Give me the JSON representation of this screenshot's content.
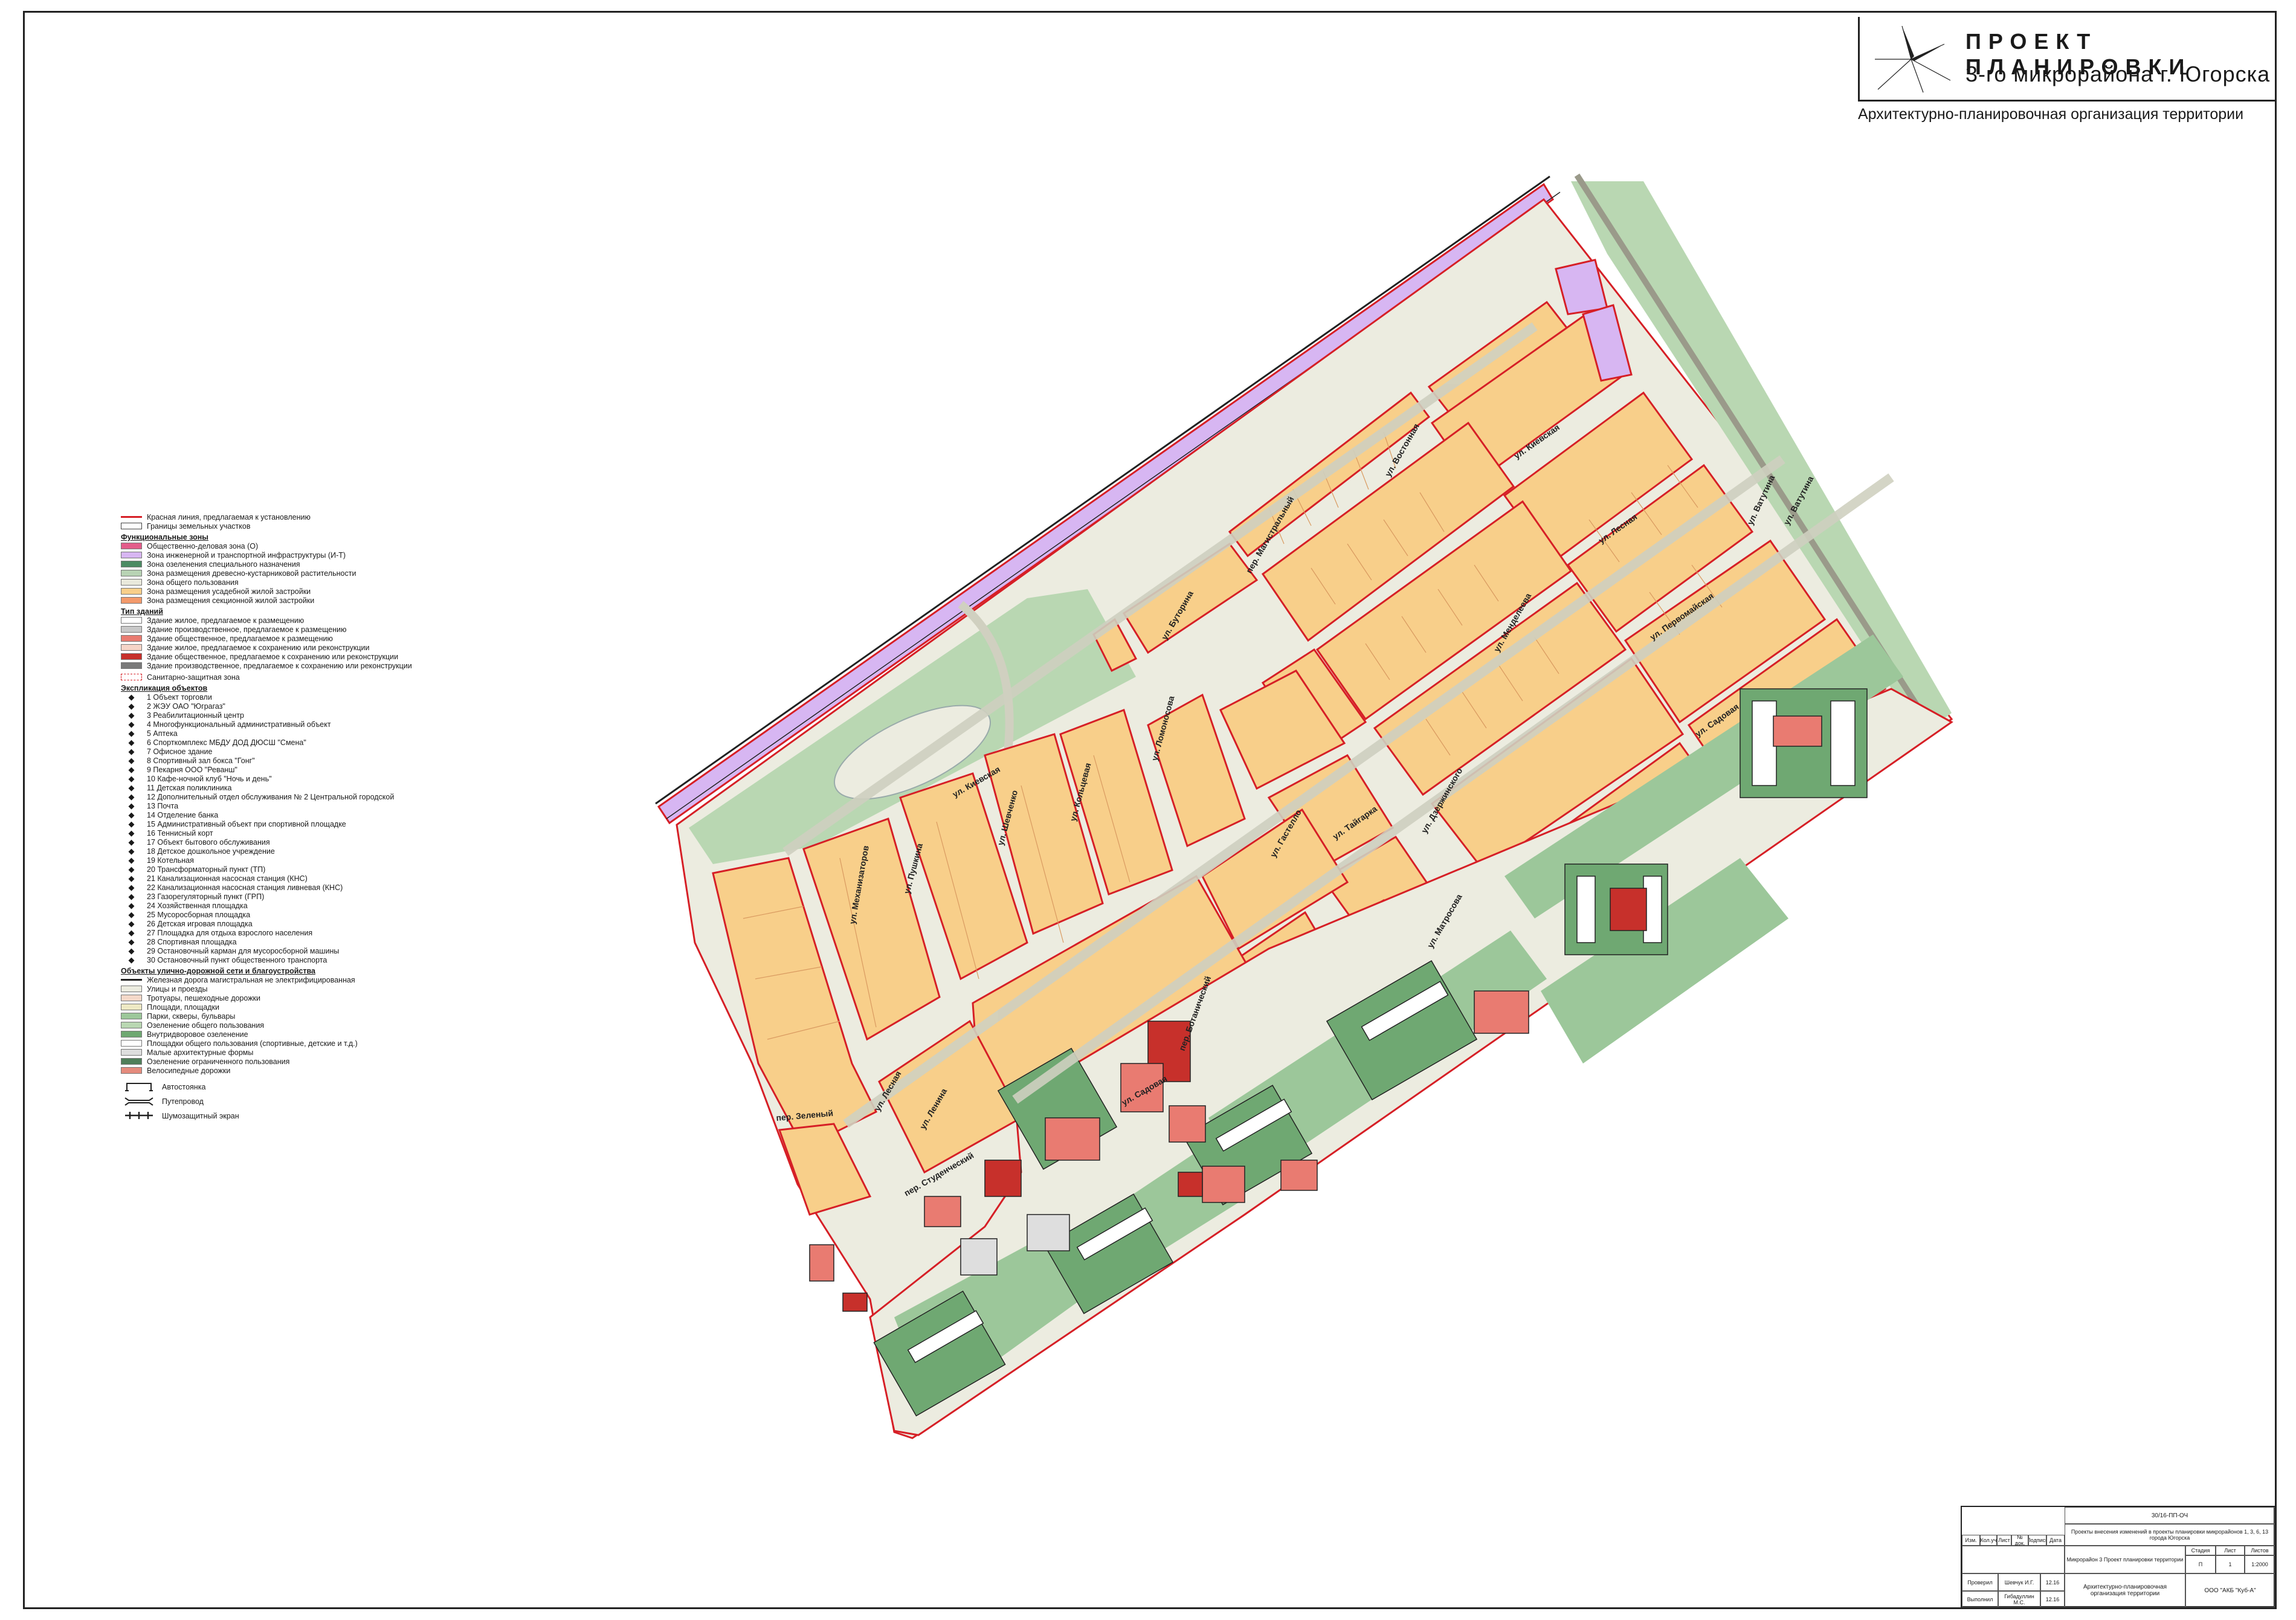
{
  "title": {
    "main": "ПРОЕКТ ПЛАНИРОВКИ",
    "sub": "3-го микрорайона  г. Югорска",
    "sheet": "Архитектурно-планировочная организация территории"
  },
  "legend": {
    "lines": [
      {
        "label": "Красная линия, предлагаемая к установлению",
        "color": "#d61f26"
      },
      {
        "label": "Границы земельных участков",
        "color": "#444444"
      }
    ],
    "zones_title": "Функциональные зоны",
    "zones": [
      {
        "label": "Общественно-деловая зона (О)",
        "color": "#e35d8a"
      },
      {
        "label": "Зона инженерной и транспортной инфраструктуры (И-Т)",
        "color": "#d7b6f2"
      },
      {
        "label": "Зона озеленения специального назначения",
        "color": "#4c8a63"
      },
      {
        "label": "Зона размещения древесно-кустарниковой растительности",
        "color": "#b8d3b4"
      },
      {
        "label": "Зона общего пользования",
        "color": "#e9e9dc"
      },
      {
        "label": "Зона размещения усадебной жилой застройки",
        "color": "#f8cf8a"
      },
      {
        "label": "Зона размещения секционной жилой застройки",
        "color": "#f39a6b"
      }
    ],
    "buildings_title": "Тип зданий",
    "buildings": [
      {
        "label": "Здание жилое, предлагаемое к размещению",
        "color": "#ffffff"
      },
      {
        "label": "Здание производственное, предлагаемое к размещению",
        "color": "#c9c9c9"
      },
      {
        "label": "Здание общественное, предлагаемое к размещению",
        "color": "#e97b71"
      },
      {
        "label": "Здание жилое, предлагаемое к сохранению или реконструкции",
        "color": "#f6d4c7"
      },
      {
        "label": "Здание общественное, предлагаемое к сохранению или реконструкции",
        "color": "#c7302b"
      },
      {
        "label": "Здание производственное, предлагаемое к сохранению или реконструкции",
        "color": "#7a7a7a"
      }
    ],
    "sanitary": "Санитарно-защитная зона",
    "objects_title": "Экспликация объектов",
    "objects": [
      "1  Объект торговли",
      "2  ЖЭУ ОАО \"Юграгаз\"",
      "3  Реабилитационный центр",
      "4  Многофункциональный административный объект",
      "5  Аптека",
      "6  Спорткомплекс МБДУ ДОД ДЮСШ \"Смена\"",
      "7  Офисное здание",
      "8  Спортивный зал бокса \"Гонг\"",
      "9  Пекарня ООО \"Реванш\"",
      "10  Кафе-ночной клуб \"Ночь и день\"",
      "11  Детская поликлиника",
      "12  Дополнительный отдел обслуживания № 2 Центральной городской",
      "13  Почта",
      "14  Отделение банка",
      "15  Административный объект при спортивной площадке",
      "16  Теннисный корт",
      "17  Объект бытового обслуживания",
      "18  Детское дошкольное учреждение",
      "19  Котельная",
      "20  Трансформаторный пункт (ТП)",
      "21  Канализационная насосная станция (КНС)",
      "22  Канализационная насосная станция ливневая (КНС)",
      "23  Газорегуляторный пункт (ГРП)",
      "24  Хозяйственная площадка",
      "25  Мусоросборная площадка",
      "26  Детская игровая площадка",
      "27  Площадка для отдыха взрослого населения",
      "28  Спортивная площадка",
      "29  Остановочный карман для мусоросборной машины",
      "30  Остановочный пункт общественного транспорта"
    ],
    "roads_title": "Объекты улично-дорожной сети и благоустройства",
    "roads": [
      {
        "label": "Железная дорога магистральная не электрифицированная",
        "color": "#222222",
        "kind": "line"
      },
      {
        "label": "Улицы и проезды",
        "color": "#ecece0",
        "kind": "box"
      },
      {
        "label": "Тротуары, пешеходные дорожки",
        "color": "#f4d9c9",
        "kind": "box"
      },
      {
        "label": "Площади, площадки",
        "color": "#eee9c4",
        "kind": "box"
      },
      {
        "label": "Парки, скверы, бульвары",
        "color": "#9cc79a",
        "kind": "box"
      },
      {
        "label": "Озеленение общего пользования",
        "color": "#b9d7b2",
        "kind": "box"
      },
      {
        "label": "Внутридворовое озеленение",
        "color": "#6fa872",
        "kind": "box"
      },
      {
        "label": "Площадки общего пользования (спортивные, детские и т.д.)",
        "color": "#ffffff",
        "kind": "box"
      },
      {
        "label": "Малые архитектурные формы",
        "color": "#dedede",
        "kind": "box"
      },
      {
        "label": "Озеленение ограниченного пользования",
        "color": "#4f7f5a",
        "kind": "box"
      },
      {
        "label": "Велосипедные дорожки",
        "color": "#e58b7d",
        "kind": "box"
      }
    ],
    "symbols": [
      "Автостоянка",
      "Путепровод",
      "Шумозащитный экран"
    ]
  },
  "streets": [
    "ул. Киевская",
    "ул. Буторина",
    "пер. Магистральный",
    "ул. Востонная",
    "ул. Лесная",
    "ул. Киевская",
    "ул. Ватутина",
    "ул. Первомайская",
    "ул. Менделеева",
    "ул. Садовая",
    "ул. Дзержинского",
    "ул. Гастелло",
    "ул. Тайгарка",
    "ул. Пушкина",
    "ул. Шевченко",
    "ул. Кольцевая",
    "ул. Ломоносова",
    "ул. Механизаторов",
    "пер. Зеленый",
    "ул. Ленина",
    "ул. Лесная",
    "пер. Студенческий",
    "ул. Садовая",
    "пер. Ботанический",
    "ул. Матросова"
  ],
  "stamp": {
    "code": "30/16-ПП-ОЧ",
    "description": "Проекты внесения изменений в проекты планировки микрорайонов 1, 3, 6, 13 города Югорска",
    "part": "Микрорайон 3 Проект планировки территории",
    "stage_label": "Стадия",
    "sheet_label": "Лист",
    "sheets_label": "Листов",
    "stage": "П",
    "sheet": "1",
    "sheets": "1",
    "scale": "1:2000",
    "cols": [
      "Изм.",
      "Кол.уч",
      "Лист",
      "№ док.",
      "Подпись",
      "Дата"
    ],
    "people": [
      {
        "role": "Проверил",
        "name": "Шевчук И.Г.",
        "date": "12.16"
      },
      {
        "role": "Выполнил",
        "name": "Гибадуллин М.С.",
        "date": "12.16"
      }
    ],
    "sheet_title": "Архитектурно-планировочная организация территории",
    "org": "ООО \"АКБ \"Куб-А\""
  }
}
